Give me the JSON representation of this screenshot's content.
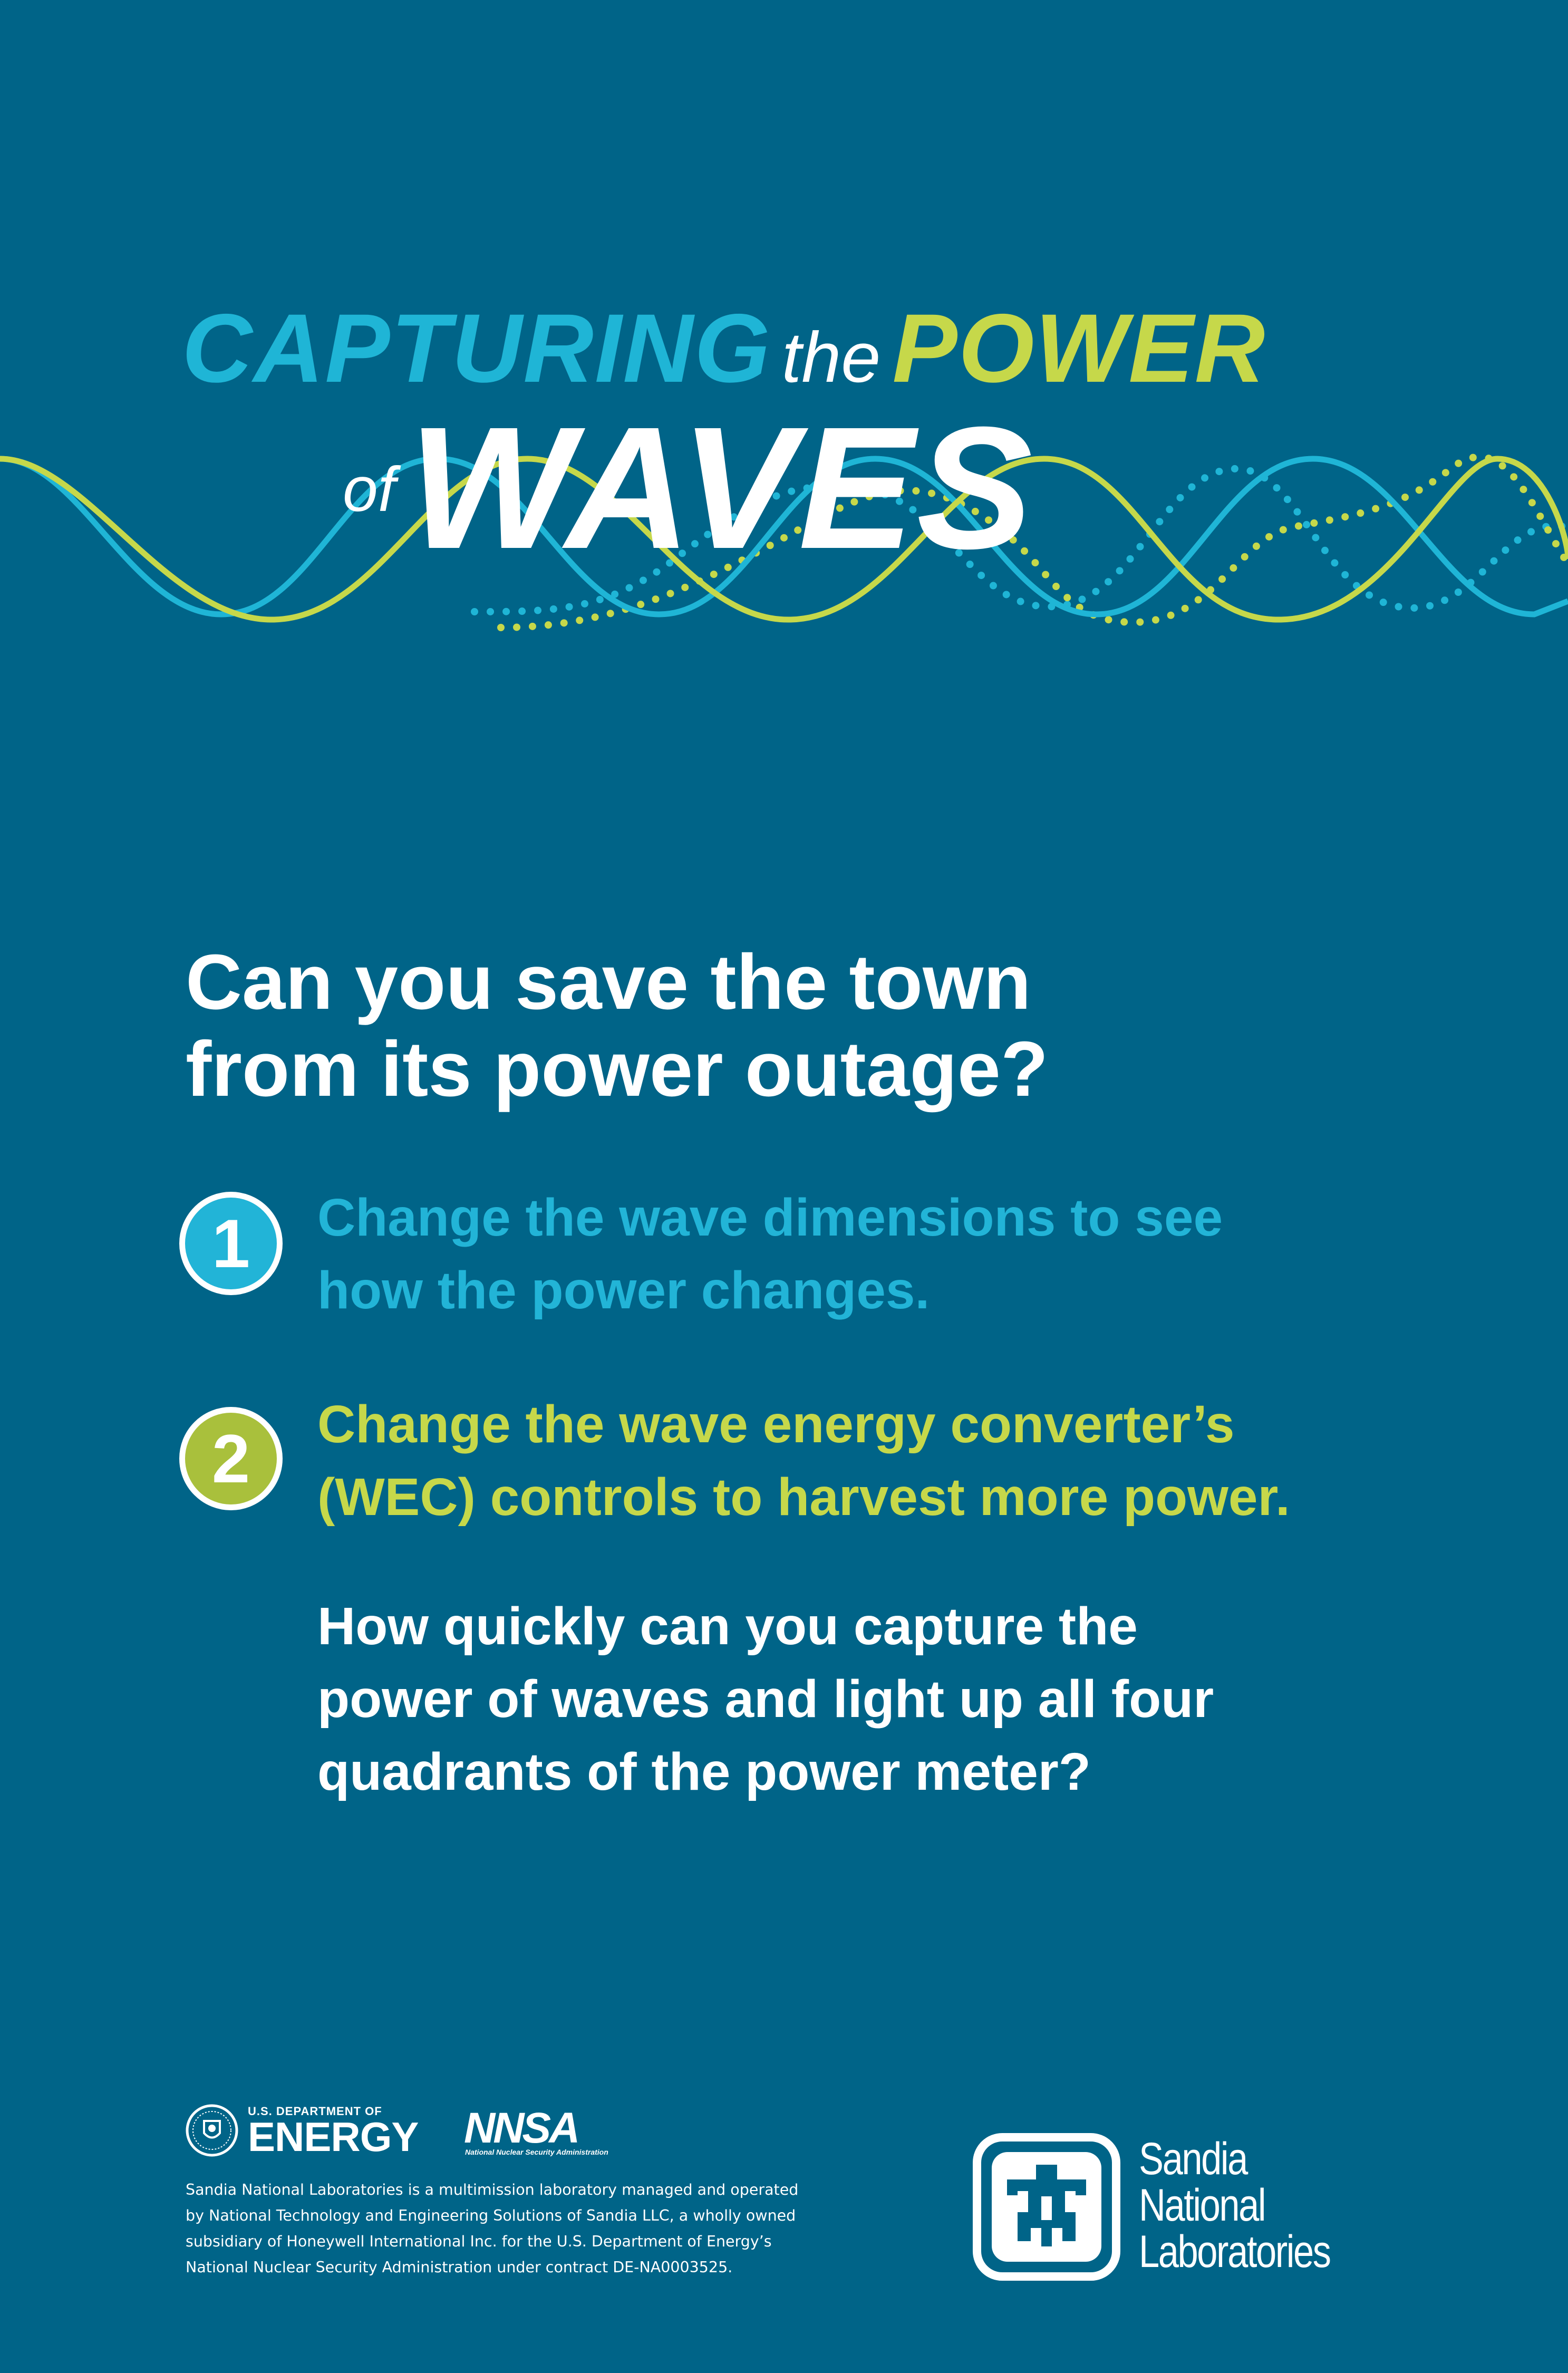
{
  "title": {
    "word1": "CAPTURING",
    "word2": "the",
    "word3": "POWER",
    "word4": "of",
    "word5": "WAVES"
  },
  "question": {
    "line1": "Can you save the town",
    "line2": "from its power outage?"
  },
  "steps": [
    {
      "number": "1",
      "line1": "Change the wave dimensions to see",
      "line2": "how the power changes."
    },
    {
      "number": "2",
      "line1": "Change the wave energy converter’s",
      "line2": "(WEC) controls to harvest more power."
    }
  ],
  "challenge": {
    "line1": "How quickly can you capture the",
    "line2": "power of waves and light up all four",
    "line3": "quadrants of the power meter?"
  },
  "footer": {
    "doe_small": "U.S. DEPARTMENT OF",
    "doe_big": "ENERGY",
    "nnsa_mark": "NNSA",
    "nnsa_sub": "National Nuclear Security Administration",
    "disclaimer_lines": [
      "Sandia National Laboratories is a multimission laboratory managed and operated",
      "by National Technology and Engineering Solutions of Sandia LLC, a wholly owned",
      "subsidiary of Honeywell International Inc. for the U.S. Department of Energy’s",
      "National Nuclear Security Administration under contract DE-NA0003525."
    ],
    "sandia_lines": [
      "Sandia",
      "National",
      "Laboratories"
    ]
  },
  "colors": {
    "background": "#006488",
    "cyan": "#1fb5d6",
    "lime": "#c6d84a",
    "white": "#ffffff"
  }
}
